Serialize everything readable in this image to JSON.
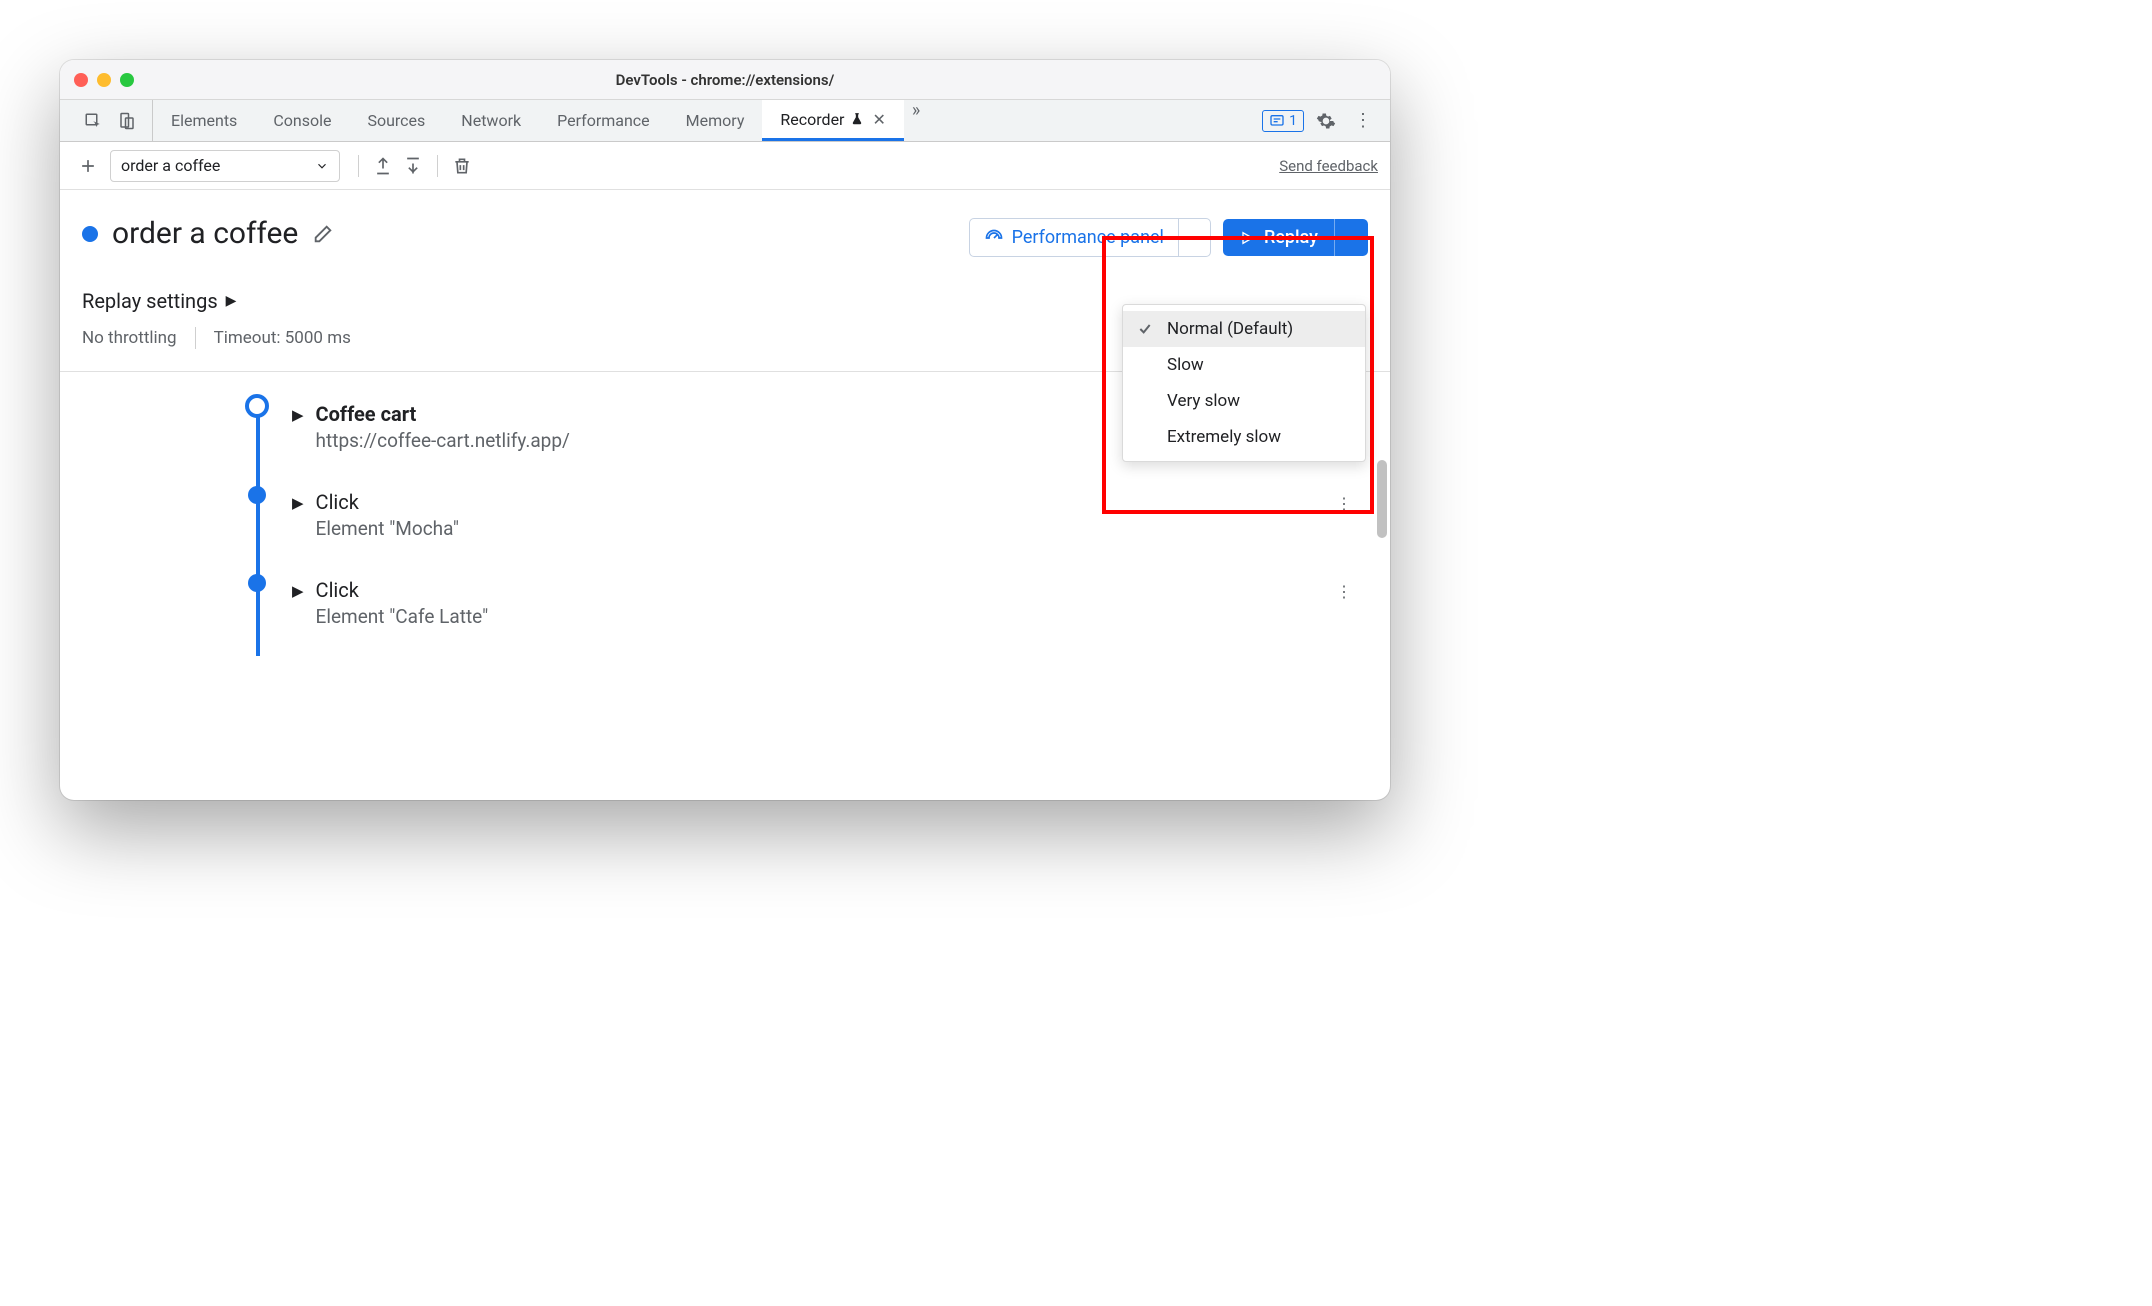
{
  "window": {
    "title": "DevTools - chrome://extensions/"
  },
  "tabs": {
    "items": [
      "Elements",
      "Console",
      "Sources",
      "Network",
      "Performance",
      "Memory",
      "Recorder"
    ],
    "active": 6,
    "issues_count": "1"
  },
  "toolbar": {
    "recording_name": "order a coffee",
    "feedback": "Send feedback"
  },
  "recording": {
    "title": "order a coffee",
    "perf_button": "Performance panel",
    "replay_button": "Replay"
  },
  "speed_menu": {
    "items": [
      "Normal (Default)",
      "Slow",
      "Very slow",
      "Extremely slow"
    ],
    "selected_index": 0
  },
  "settings": {
    "heading": "Replay settings",
    "throttling": "No throttling",
    "timeout": "Timeout: 5000 ms"
  },
  "steps": [
    {
      "title": "Coffee cart",
      "sub": "https://coffee-cart.netlify.app/",
      "first": true
    },
    {
      "title": "Click",
      "sub": "Element \"Mocha\""
    },
    {
      "title": "Click",
      "sub": "Element \"Cafe Latte\""
    }
  ]
}
